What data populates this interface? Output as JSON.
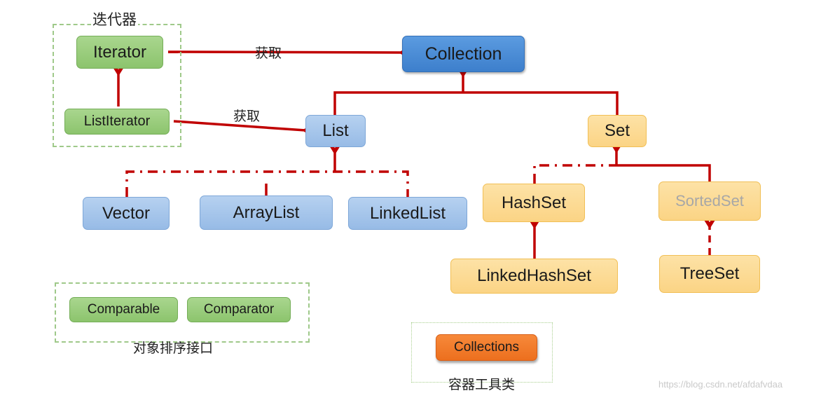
{
  "diagram": {
    "nodes": {
      "collection": "Collection",
      "list": "List",
      "set": "Set",
      "iterator": "Iterator",
      "list_iterator": "ListIterator",
      "vector": "Vector",
      "array_list": "ArrayList",
      "linked_list": "LinkedList",
      "hash_set": "HashSet",
      "sorted_set": "SortedSet",
      "linked_hash_set": "LinkedHashSet",
      "tree_set": "TreeSet",
      "comparable": "Comparable",
      "comparator": "Comparator",
      "collections": "Collections"
    },
    "group_labels": {
      "iterators": "迭代器",
      "sorting_interfaces": "对象排序接口",
      "container_utils": "容器工具类"
    },
    "edge_labels": {
      "collection_to_iterator": "获取",
      "list_to_list_iterator": "获取"
    },
    "edges": [
      {
        "from": "Collection",
        "to": "Iterator",
        "style": "solid",
        "label": "获取"
      },
      {
        "from": "List",
        "to": "ListIterator",
        "style": "solid",
        "label": "获取"
      },
      {
        "from": "ListIterator",
        "to": "Iterator",
        "style": "solid"
      },
      {
        "from": "List",
        "to": "Collection",
        "style": "solid"
      },
      {
        "from": "Set",
        "to": "Collection",
        "style": "solid"
      },
      {
        "from": "Vector",
        "to": "List",
        "style": "dash-dot"
      },
      {
        "from": "ArrayList",
        "to": "List",
        "style": "dash-dot"
      },
      {
        "from": "LinkedList",
        "to": "List",
        "style": "dash-dot"
      },
      {
        "from": "HashSet",
        "to": "Set",
        "style": "dash-dot"
      },
      {
        "from": "SortedSet",
        "to": "Set",
        "style": "solid"
      },
      {
        "from": "LinkedHashSet",
        "to": "HashSet",
        "style": "solid"
      },
      {
        "from": "TreeSet",
        "to": "SortedSet",
        "style": "dashed"
      }
    ],
    "colors": {
      "arrow": "#c00000",
      "interface_green": "#8cc46d",
      "collection_blue": "#3d7fcc",
      "list_blue": "#97bbe6",
      "set_yellow": "#fbd485",
      "utility_orange": "#ec6f1e"
    }
  },
  "watermark": "https://blog.csdn.net/afdafvdaa"
}
